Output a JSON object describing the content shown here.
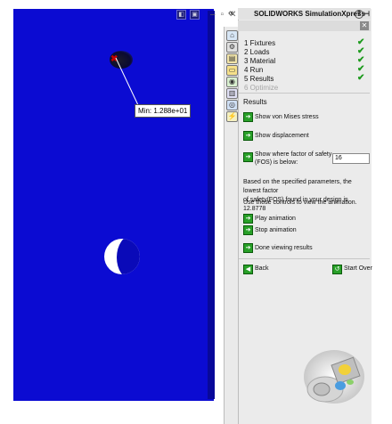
{
  "panel": {
    "collapse_glyph": "«",
    "title": "SOLIDWORKS SimulationXpress",
    "help_glyph": "?",
    "pin_glyph": "⊣",
    "close_glyph": "✕"
  },
  "viewport": {
    "min_label": "Min: 1.288e+01",
    "marker_glyph": "✖",
    "controls": [
      "–",
      "▫",
      "✕"
    ]
  },
  "steps": [
    {
      "label": "1 Fixtures",
      "done": true
    },
    {
      "label": "2 Loads",
      "done": true
    },
    {
      "label": "3 Material",
      "done": true
    },
    {
      "label": "4 Run",
      "done": true
    },
    {
      "label": "5 Results",
      "done": true
    },
    {
      "label": "6 Optimize",
      "done": false
    }
  ],
  "check_glyph": "✔",
  "results": {
    "heading": "Results",
    "show_stress": "Show von Mises stress",
    "show_displacement": "Show displacement",
    "show_fos_line1": "Show where factor of safety",
    "show_fos_line2": "(FOS) is below:",
    "fos_value": "16",
    "info_line1": "Based on the specified parameters, the lowest factor",
    "info_line2": "of safety(FOS) found in your design is 12.8778",
    "anim_hint": "Use these controls to view the animation.",
    "play": "Play animation",
    "stop": "Stop animation",
    "done": "Done viewing results",
    "back": "Back",
    "start_over": "Start Over"
  },
  "icons": {
    "arrow_glyph": "➔",
    "back_glyph": "◀",
    "start_glyph": "↺"
  },
  "colors": {
    "part_blue": "#0b0bd2",
    "check_green": "#1c9a1c",
    "button_green": "#28a028",
    "min_marker_red": "#c40000"
  }
}
